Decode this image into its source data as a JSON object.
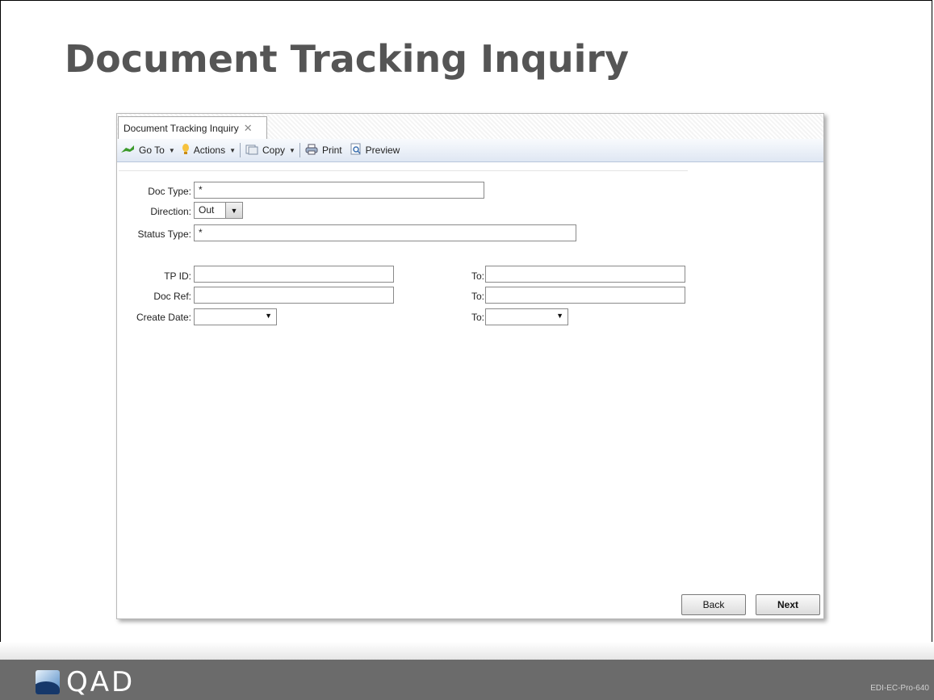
{
  "slide": {
    "title": "Document Tracking Inquiry",
    "code": "EDI-EC-Pro-640",
    "logo_text": "QAD"
  },
  "window": {
    "tab_label": "Document Tracking Inquiry",
    "toolbar": {
      "goto_label": "Go To",
      "actions_label": "Actions",
      "copy_label": "Copy",
      "print_label": "Print",
      "preview_label": "Preview"
    },
    "form": {
      "doc_type": {
        "label": "Doc Type:",
        "value": "*"
      },
      "direction": {
        "label": "Direction:",
        "value": "Out"
      },
      "status_type": {
        "label": "Status Type:",
        "value": "*"
      },
      "tp_id": {
        "label": "TP ID:",
        "value": "",
        "to_label": "To:",
        "to_value": ""
      },
      "doc_ref": {
        "label": "Doc Ref:",
        "value": "",
        "to_label": "To:",
        "to_value": ""
      },
      "create_date": {
        "label": "Create Date:",
        "value": "",
        "to_label": "To:",
        "to_value": ""
      }
    },
    "buttons": {
      "back": "Back",
      "next": "Next"
    }
  },
  "icons": [
    "goto-arrow-icon",
    "actions-bulb-icon",
    "copy-icon",
    "print-icon",
    "preview-icon",
    "close-icon",
    "chevron-down-icon",
    "qad-logo"
  ]
}
